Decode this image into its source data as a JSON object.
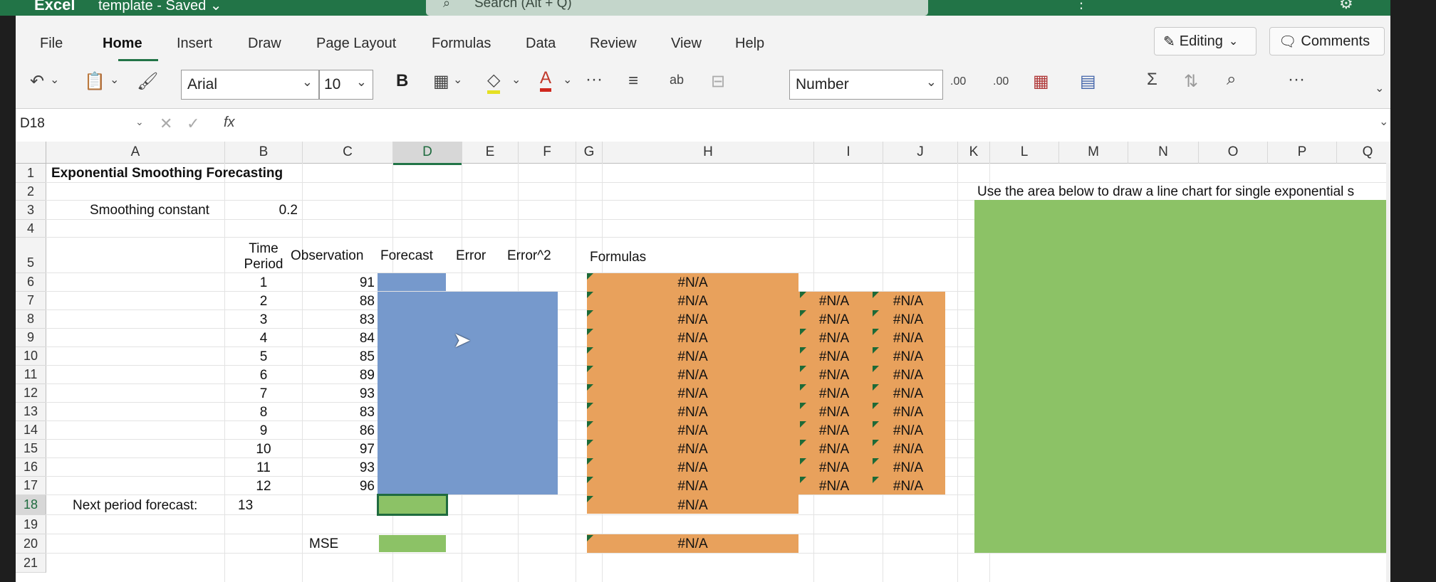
{
  "titlebar": {
    "app": "Excel",
    "doc": "template - Saved ⌄",
    "search_placeholder": "Search (Alt + Q)"
  },
  "tabs": [
    "File",
    "Home",
    "Insert",
    "Draw",
    "Page Layout",
    "Formulas",
    "Data",
    "Review",
    "View",
    "Help"
  ],
  "buttons": {
    "editing": "Editing",
    "comments": "Comments"
  },
  "toolbar": {
    "font": "Arial",
    "size": "10",
    "bold": "B",
    "number_format": "Number",
    "more": "···",
    "inc_decimal": ".00",
    "dec_decimal": ".00"
  },
  "formula_bar": {
    "name_box": "D18",
    "fx": "fx",
    "value": ""
  },
  "columns": [
    "A",
    "B",
    "C",
    "D",
    "E",
    "F",
    "G",
    "H",
    "I",
    "J",
    "K",
    "L",
    "M",
    "N",
    "O",
    "P",
    "Q"
  ],
  "rows": [
    "1",
    "2",
    "3",
    "4",
    "5",
    "6",
    "7",
    "8",
    "9",
    "10",
    "11",
    "12",
    "13",
    "14",
    "15",
    "16",
    "17",
    "18",
    "19",
    "20",
    "21"
  ],
  "sheet": {
    "title": "Exponential Smoothing Forecasting",
    "smoothing_label": "Smoothing constant",
    "smoothing_value": "0.2",
    "headers": {
      "time_period_1": "Time",
      "time_period_2": "Period",
      "observation": "Observation",
      "forecast": "Forecast",
      "error": "Error",
      "error2": "Error^2",
      "formulas": "Formulas"
    },
    "time_periods": [
      "1",
      "2",
      "3",
      "4",
      "5",
      "6",
      "7",
      "8",
      "9",
      "10",
      "11",
      "12"
    ],
    "observations": [
      "91",
      "88",
      "83",
      "84",
      "85",
      "89",
      "93",
      "83",
      "86",
      "97",
      "93",
      "96"
    ],
    "na": "#N/A",
    "next_period_label": "Next period forecast:",
    "next_period_value": "13",
    "mse_label": "MSE",
    "chart_note": "Use the area below to draw a line chart for single exponential s"
  },
  "colors": {
    "excel_green": "#227447",
    "orange": "#E8A15C",
    "blue": "#7699CC",
    "green": "#8CC266"
  }
}
